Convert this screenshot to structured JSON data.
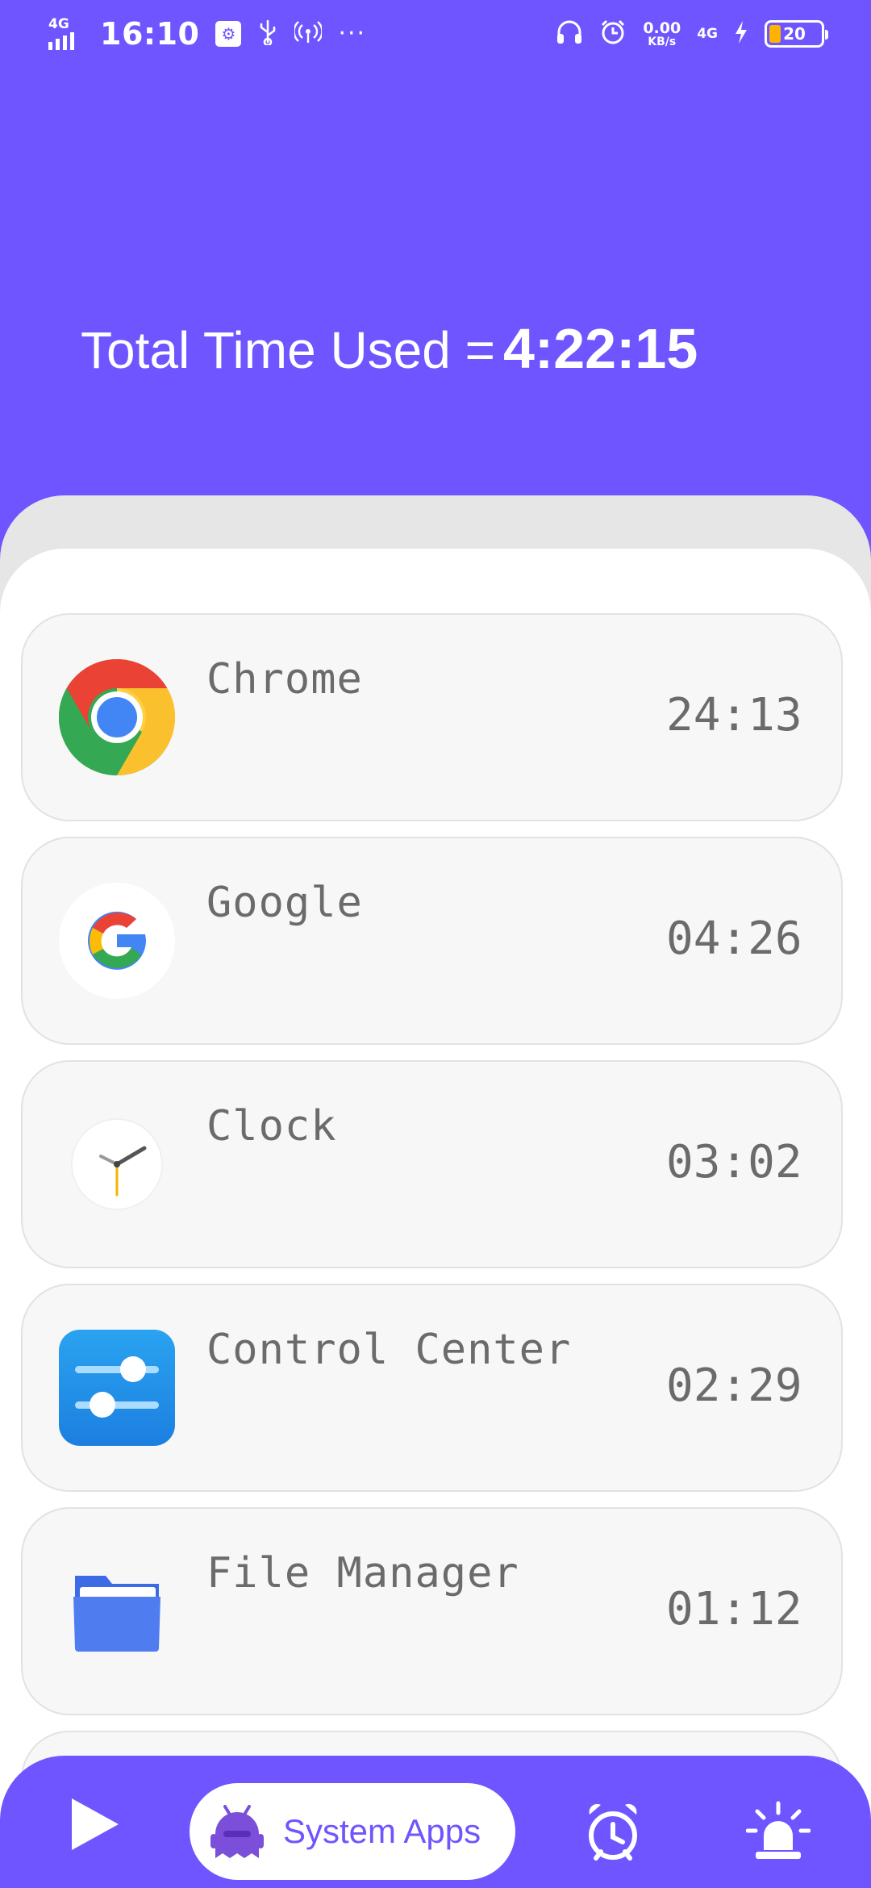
{
  "status_bar": {
    "network_left": "4G",
    "time": "16:10",
    "speed_value": "0.00",
    "speed_unit": "KB/s",
    "network_right": "4G",
    "battery_level": "20",
    "icons": [
      "signal-icon",
      "usb-debug-icon",
      "usb-icon",
      "hotspot-icon",
      "more-dots-icon",
      "headphones-icon",
      "alarm-icon",
      "charging-icon",
      "battery-icon"
    ]
  },
  "header": {
    "total_label": "Total Time Used =",
    "total_value": "4:22:15"
  },
  "apps": [
    {
      "name": "Chrome",
      "time": "24:13",
      "icon": "chrome-icon"
    },
    {
      "name": "Google",
      "time": "04:26",
      "icon": "google-icon"
    },
    {
      "name": "Clock",
      "time": "03:02",
      "icon": "clock-icon"
    },
    {
      "name": "Control Center",
      "time": "02:29",
      "icon": "control-center-icon"
    },
    {
      "name": "File Manager",
      "time": "01:12",
      "icon": "file-manager-icon"
    }
  ],
  "bottom_nav": {
    "items": [
      {
        "icon": "play-icon"
      },
      {
        "icon": "android-ghost-icon",
        "label": "System Apps",
        "selected": true
      },
      {
        "icon": "alarm-clock-icon"
      },
      {
        "icon": "siren-icon"
      }
    ]
  },
  "colors": {
    "primary": "#6e55ff",
    "card_bg": "#f7f7f7",
    "text_gray": "#6b6b6b",
    "panel_back": "#e6e6e6"
  }
}
